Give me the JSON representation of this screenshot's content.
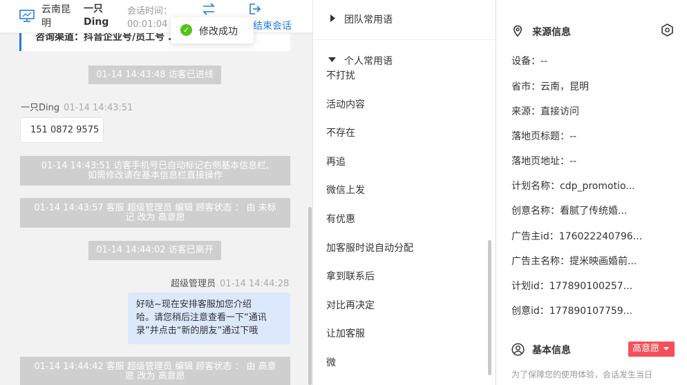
{
  "chat": {
    "header": {
      "location": "云南昆明",
      "nickname": "一只Ding",
      "session_time_label": "会话时间：",
      "session_time_value": "00:01:04",
      "end_label": "结束会话"
    },
    "toast": "修改成功",
    "channel_text": "咨询渠道：抖音企业号/员工号 ... 50...",
    "messages": {
      "sys1": "01-14 14:43:48 访客已进线",
      "visitor_name": "一只Ding",
      "visitor_time": "01-14 14:43:51",
      "visitor_msg": "151 0872 9575",
      "sys2_line1": "01-14 14:43:51 访客手机号已自动标记右侧基本信息栏,",
      "sys2_line2": "如需修改请在基本信息栏直接操作",
      "sys3_line1": "01-14 14:43:57 客服 超级管理员 编辑 顾客状态 ： 由 未标",
      "sys3_line2": "记 改为 高意愿",
      "sys4": "01-14 14:44:02 访客已离开",
      "agent_name": "超级管理员",
      "agent_time": "01-14 14:44:28",
      "agent_line1": "好哒~现在安排客服加您介绍",
      "agent_line2": "哈。请您稍后注意查看一下“通讯",
      "agent_line3": "录”并点击“新的朋友”通过下哦",
      "sys5_line1": "01-14 14:44:42 客服 超级管理员 编辑 顾客状态 ： 由 高意",
      "sys5_line2": "愿 改为 高意愿"
    }
  },
  "phrases": {
    "team_label": "团队常用语",
    "personal_label": "个人常用语",
    "items": [
      "不打扰",
      "活动内容",
      "不存在",
      "再追",
      "微信上发",
      "有优惠",
      "加客服时说自动分配",
      "拿到联系后",
      "对比再决定",
      "让加客服",
      "微"
    ]
  },
  "info": {
    "source_title": "来源信息",
    "rows": [
      "设备：--",
      "省市：云南，昆明",
      "来源：直接访问",
      "落地页标题：--",
      "落地页地址：--",
      "计划名称：cdp_promotio...",
      "创意名称：看腻了传统婚...",
      "广告主id：176022240796...",
      "广告主名称：提米映画婚前...",
      "计划id：177890100257...",
      "创意id：177890107759..."
    ],
    "basic_title": "基本信息",
    "status_badge": "高意愿",
    "notice": "为了保障您的使用体验，会话发生当日"
  },
  "colors": {
    "accent": "#1f7be0",
    "badge": "#f5505a",
    "success": "#52c41a",
    "system_msg_bg": "#cfcfcf",
    "agent_bubble_bg": "#dce8fb"
  }
}
